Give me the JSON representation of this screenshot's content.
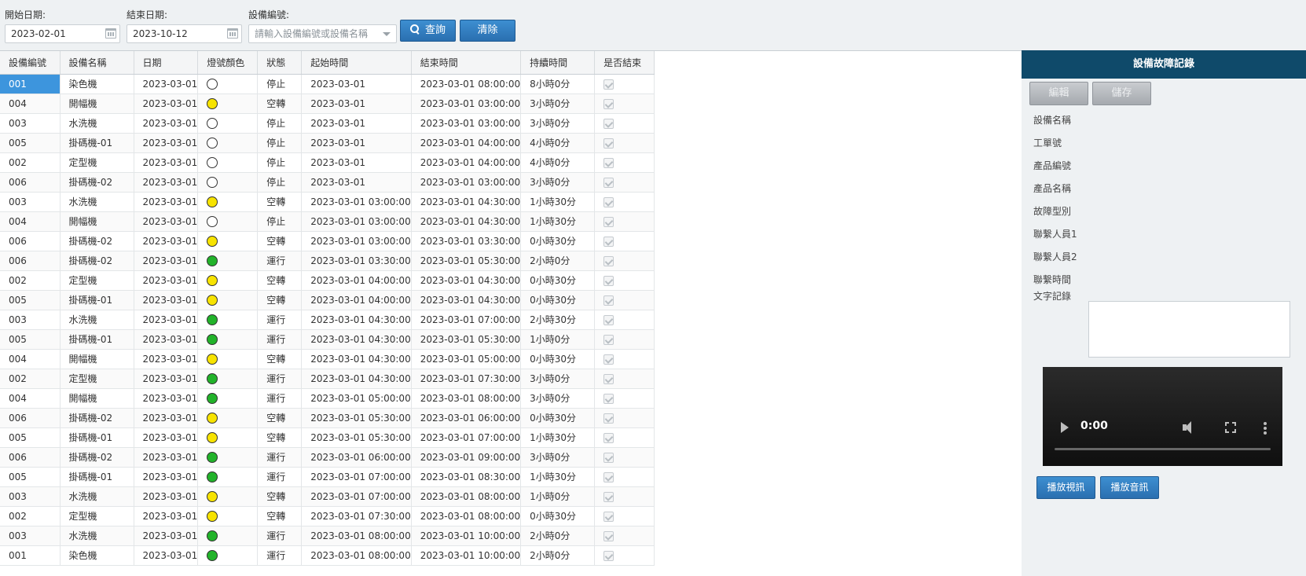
{
  "filter": {
    "start_label": "開始日期:",
    "start_value": "2023-02-01",
    "end_label": "結束日期:",
    "end_value": "2023-10-12",
    "device_label": "設備編號:",
    "device_placeholder": "請輸入設備編號或設備名稱",
    "query_label": "查詢",
    "clear_label": "清除"
  },
  "grid": {
    "columns": [
      "設備編號",
      "設備名稱",
      "日期",
      "燈號顏色",
      "狀態",
      "起始時間",
      "結束時間",
      "持續時間",
      "是否結束"
    ],
    "lamp_colors": {
      "white": "#ffffff",
      "yellow": "#f7e300",
      "green": "#22b32a"
    },
    "rows": [
      {
        "id": "001",
        "name": "染色機",
        "date": "2023-03-01",
        "lamp": "white",
        "status": "停止",
        "start": "2023-03-01",
        "end": "2023-03-01 08:00:00",
        "duration": "8小時0分"
      },
      {
        "id": "004",
        "name": "開幅機",
        "date": "2023-03-01",
        "lamp": "yellow",
        "status": "空轉",
        "start": "2023-03-01",
        "end": "2023-03-01 03:00:00",
        "duration": "3小時0分"
      },
      {
        "id": "003",
        "name": "水洗機",
        "date": "2023-03-01",
        "lamp": "white",
        "status": "停止",
        "start": "2023-03-01",
        "end": "2023-03-01 03:00:00",
        "duration": "3小時0分"
      },
      {
        "id": "005",
        "name": "掛碼機-01",
        "date": "2023-03-01",
        "lamp": "white",
        "status": "停止",
        "start": "2023-03-01",
        "end": "2023-03-01 04:00:00",
        "duration": "4小時0分"
      },
      {
        "id": "002",
        "name": "定型機",
        "date": "2023-03-01",
        "lamp": "white",
        "status": "停止",
        "start": "2023-03-01",
        "end": "2023-03-01 04:00:00",
        "duration": "4小時0分"
      },
      {
        "id": "006",
        "name": "掛碼機-02",
        "date": "2023-03-01",
        "lamp": "white",
        "status": "停止",
        "start": "2023-03-01",
        "end": "2023-03-01 03:00:00",
        "duration": "3小時0分"
      },
      {
        "id": "003",
        "name": "水洗機",
        "date": "2023-03-01",
        "lamp": "yellow",
        "status": "空轉",
        "start": "2023-03-01 03:00:00",
        "end": "2023-03-01 04:30:00",
        "duration": "1小時30分"
      },
      {
        "id": "004",
        "name": "開幅機",
        "date": "2023-03-01",
        "lamp": "white",
        "status": "停止",
        "start": "2023-03-01 03:00:00",
        "end": "2023-03-01 04:30:00",
        "duration": "1小時30分"
      },
      {
        "id": "006",
        "name": "掛碼機-02",
        "date": "2023-03-01",
        "lamp": "yellow",
        "status": "空轉",
        "start": "2023-03-01 03:00:00",
        "end": "2023-03-01 03:30:00",
        "duration": "0小時30分"
      },
      {
        "id": "006",
        "name": "掛碼機-02",
        "date": "2023-03-01",
        "lamp": "green",
        "status": "運行",
        "start": "2023-03-01 03:30:00",
        "end": "2023-03-01 05:30:00",
        "duration": "2小時0分"
      },
      {
        "id": "002",
        "name": "定型機",
        "date": "2023-03-01",
        "lamp": "yellow",
        "status": "空轉",
        "start": "2023-03-01 04:00:00",
        "end": "2023-03-01 04:30:00",
        "duration": "0小時30分"
      },
      {
        "id": "005",
        "name": "掛碼機-01",
        "date": "2023-03-01",
        "lamp": "yellow",
        "status": "空轉",
        "start": "2023-03-01 04:00:00",
        "end": "2023-03-01 04:30:00",
        "duration": "0小時30分"
      },
      {
        "id": "003",
        "name": "水洗機",
        "date": "2023-03-01",
        "lamp": "green",
        "status": "運行",
        "start": "2023-03-01 04:30:00",
        "end": "2023-03-01 07:00:00",
        "duration": "2小時30分"
      },
      {
        "id": "005",
        "name": "掛碼機-01",
        "date": "2023-03-01",
        "lamp": "green",
        "status": "運行",
        "start": "2023-03-01 04:30:00",
        "end": "2023-03-01 05:30:00",
        "duration": "1小時0分"
      },
      {
        "id": "004",
        "name": "開幅機",
        "date": "2023-03-01",
        "lamp": "yellow",
        "status": "空轉",
        "start": "2023-03-01 04:30:00",
        "end": "2023-03-01 05:00:00",
        "duration": "0小時30分"
      },
      {
        "id": "002",
        "name": "定型機",
        "date": "2023-03-01",
        "lamp": "green",
        "status": "運行",
        "start": "2023-03-01 04:30:00",
        "end": "2023-03-01 07:30:00",
        "duration": "3小時0分"
      },
      {
        "id": "004",
        "name": "開幅機",
        "date": "2023-03-01",
        "lamp": "green",
        "status": "運行",
        "start": "2023-03-01 05:00:00",
        "end": "2023-03-01 08:00:00",
        "duration": "3小時0分"
      },
      {
        "id": "006",
        "name": "掛碼機-02",
        "date": "2023-03-01",
        "lamp": "yellow",
        "status": "空轉",
        "start": "2023-03-01 05:30:00",
        "end": "2023-03-01 06:00:00",
        "duration": "0小時30分"
      },
      {
        "id": "005",
        "name": "掛碼機-01",
        "date": "2023-03-01",
        "lamp": "yellow",
        "status": "空轉",
        "start": "2023-03-01 05:30:00",
        "end": "2023-03-01 07:00:00",
        "duration": "1小時30分"
      },
      {
        "id": "006",
        "name": "掛碼機-02",
        "date": "2023-03-01",
        "lamp": "green",
        "status": "運行",
        "start": "2023-03-01 06:00:00",
        "end": "2023-03-01 09:00:00",
        "duration": "3小時0分"
      },
      {
        "id": "005",
        "name": "掛碼機-01",
        "date": "2023-03-01",
        "lamp": "green",
        "status": "運行",
        "start": "2023-03-01 07:00:00",
        "end": "2023-03-01 08:30:00",
        "duration": "1小時30分"
      },
      {
        "id": "003",
        "name": "水洗機",
        "date": "2023-03-01",
        "lamp": "yellow",
        "status": "空轉",
        "start": "2023-03-01 07:00:00",
        "end": "2023-03-01 08:00:00",
        "duration": "1小時0分"
      },
      {
        "id": "002",
        "name": "定型機",
        "date": "2023-03-01",
        "lamp": "yellow",
        "status": "空轉",
        "start": "2023-03-01 07:30:00",
        "end": "2023-03-01 08:00:00",
        "duration": "0小時30分"
      },
      {
        "id": "003",
        "name": "水洗機",
        "date": "2023-03-01",
        "lamp": "green",
        "status": "運行",
        "start": "2023-03-01 08:00:00",
        "end": "2023-03-01 10:00:00",
        "duration": "2小時0分"
      },
      {
        "id": "001",
        "name": "染色機",
        "date": "2023-03-01",
        "lamp": "green",
        "status": "運行",
        "start": "2023-03-01 08:00:00",
        "end": "2023-03-01 10:00:00",
        "duration": "2小時0分"
      }
    ]
  },
  "panel": {
    "title": "設備故障記錄",
    "edit_label": "編輯",
    "save_label": "儲存",
    "fields": [
      "設備名稱",
      "工單號",
      "產品編號",
      "產品名稱",
      "故障型別",
      "聯繫人員1",
      "聯繫人員2",
      "聯繫時間"
    ],
    "text_record_label": "文字記錄",
    "video_time": "0:00",
    "play_video_label": "播放視訊",
    "play_audio_label": "播放音訊"
  }
}
